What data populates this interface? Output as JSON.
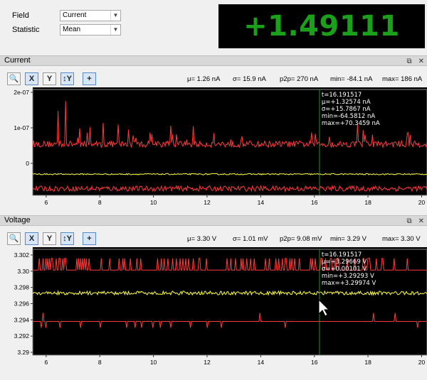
{
  "controls": {
    "field_label": "Field",
    "field_value": "Current",
    "statistic_label": "Statistic",
    "statistic_value": "Mean"
  },
  "big_readout": "+1.49111 nA",
  "icons": {
    "zoom": "magnifier-icon",
    "x_zoom": "x-axis-zoom-icon",
    "y_zoom": "y-axis-zoom-icon",
    "y_auto": "y-autoscale-icon",
    "crosshair": "crosshair-icon",
    "undock": "undock-icon",
    "close": "close-icon"
  },
  "toolbar_labels": {
    "zoom": "🔍",
    "x": "X",
    "y": "Y",
    "iy": "↕Y",
    "cross": "+"
  },
  "panels": {
    "current": {
      "title": "Current",
      "stats": {
        "mu_label": "μ=",
        "mu": "1.26 nA",
        "sigma_label": "σ=",
        "sigma": "15.9 nA",
        "p2p_label": "p2p=",
        "p2p": "270 nA",
        "min_label": "min=",
        "min": "-84.1 nA",
        "max_label": "max=",
        "max": "186 nA"
      },
      "annotation": [
        "t=16.191517",
        "μ=+1.32574 nA",
        "σ=+15.7867 nA",
        "min=-64.5812 nA",
        "max=+70.3459 nA"
      ],
      "yticks": [
        "2e-07",
        "1e-07",
        "0"
      ],
      "xticks": [
        "6",
        "8",
        "10",
        "12",
        "14",
        "16",
        "18",
        "20"
      ]
    },
    "voltage": {
      "title": "Voltage",
      "stats": {
        "mu_label": "μ=",
        "mu": "3.30 V",
        "sigma_label": "σ=",
        "sigma": "1.01 mV",
        "p2p_label": "p2p=",
        "p2p": "9.08 mV",
        "min_label": "min=",
        "min": "3.29 V",
        "max_label": "max=",
        "max": "3.30 V"
      },
      "annotation": [
        "t=16.191517",
        "μ=+3.29669  V",
        "σ=+0.00101  V",
        "min=+3.29293  V",
        "max=+3.29974  V"
      ],
      "yticks": [
        "3.302",
        "3.30",
        "3.298",
        "3.296",
        "3.294",
        "3.292",
        "3.29"
      ],
      "xticks": [
        "6",
        "8",
        "10",
        "12",
        "14",
        "16",
        "18",
        "20"
      ]
    }
  },
  "chart_data": [
    {
      "type": "line",
      "title": "Current",
      "xlim": [
        5.5,
        20.2
      ],
      "ylim": [
        -5e-08,
        2e-07
      ],
      "cursor_x": 16.191517,
      "series": [
        {
          "color": "#ff3b3b",
          "baseline": 6.8e-08,
          "kind": "upper"
        },
        {
          "color": "#ffff40",
          "baseline": 0.0,
          "kind": "mean"
        },
        {
          "color": "#ff3b3b",
          "baseline": -3.4e-08,
          "kind": "lower"
        }
      ]
    },
    {
      "type": "line",
      "title": "Voltage",
      "xlim": [
        5.5,
        20.2
      ],
      "ylim": [
        3.2887,
        3.3025
      ],
      "cursor_x": 16.191517,
      "series": [
        {
          "color": "#ff3b3b",
          "baseline": 3.2998,
          "kind": "upper"
        },
        {
          "color": "#ffff40",
          "baseline": 3.2968,
          "kind": "mean"
        },
        {
          "color": "#ff3b3b",
          "baseline": 3.2931,
          "kind": "lower"
        }
      ]
    }
  ]
}
